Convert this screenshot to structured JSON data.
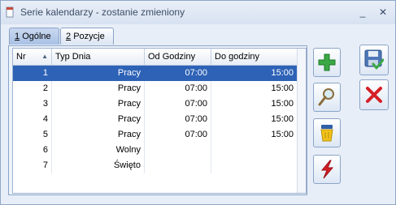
{
  "window": {
    "title": "Serie kalendarzy - zostanie zmieniony",
    "min_icon": "minimize-icon",
    "close_icon": "close-icon"
  },
  "tabs": [
    {
      "num": "1",
      "label": "Ogólne",
      "active": true
    },
    {
      "num": "2",
      "label": "Pozycje",
      "active": false
    }
  ],
  "grid": {
    "columns": [
      "Nr",
      "Typ Dnia",
      "Od Godziny",
      "Do godziny"
    ],
    "rows": [
      {
        "nr": "1",
        "typ": "Pracy",
        "od": "07:00",
        "do": "15:00",
        "selected": true
      },
      {
        "nr": "2",
        "typ": "Pracy",
        "od": "07:00",
        "do": "15:00"
      },
      {
        "nr": "3",
        "typ": "Pracy",
        "od": "07:00",
        "do": "15:00"
      },
      {
        "nr": "4",
        "typ": "Pracy",
        "od": "07:00",
        "do": "15:00"
      },
      {
        "nr": "5",
        "typ": "Pracy",
        "od": "07:00",
        "do": "15:00"
      },
      {
        "nr": "6",
        "typ": "Wolny",
        "od": "",
        "do": ""
      },
      {
        "nr": "7",
        "typ": "Święto",
        "od": "",
        "do": ""
      }
    ]
  },
  "toolbar": {
    "add": "plus-icon",
    "view": "magnifier-icon",
    "delete": "trash-icon",
    "generate": "lightning-icon",
    "save": "save-icon",
    "cancel": "cancel-icon"
  },
  "colors": {
    "selection": "#2d62b6",
    "green": "#3aa845",
    "red": "#d61f26"
  }
}
